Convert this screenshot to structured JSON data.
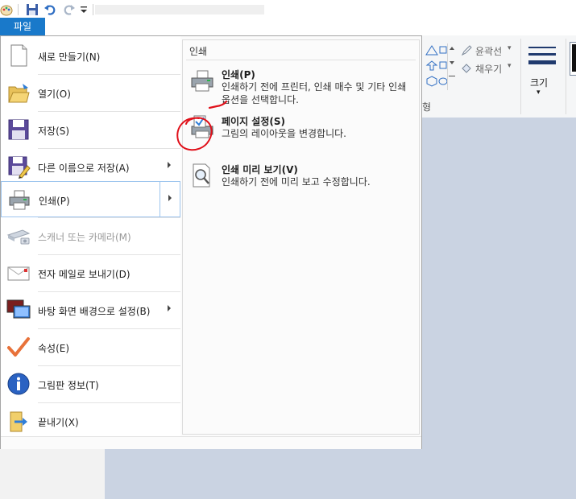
{
  "file_tab": {
    "label": "파일"
  },
  "menu": {
    "items": [
      {
        "label": "새로 만들기(N)",
        "icon": "new-document-icon"
      },
      {
        "label": "열기(O)",
        "icon": "open-folder-icon"
      },
      {
        "label": "저장(S)",
        "icon": "save-disk-icon"
      },
      {
        "label": "다른 이름으로 저장(A)",
        "icon": "save-as-icon"
      },
      {
        "label": "인쇄(P)",
        "icon": "printer-icon"
      },
      {
        "label": "스캐너 또는 카메라(M)",
        "icon": "scanner-icon"
      },
      {
        "label": "전자 메일로 보내기(D)",
        "icon": "email-icon"
      },
      {
        "label": "바탕 화면 배경으로 설정(B)",
        "icon": "desktop-background-icon"
      },
      {
        "label": "속성(E)",
        "icon": "properties-check-icon"
      },
      {
        "label": "그림판 정보(T)",
        "icon": "info-icon"
      },
      {
        "label": "끝내기(X)",
        "icon": "exit-icon"
      }
    ]
  },
  "print_panel": {
    "title": "인쇄",
    "options": [
      {
        "title": "인쇄(P)",
        "desc": "인쇄하기 전에 프린터, 인쇄 매수 및 기타 인쇄 옵션을 선택합니다."
      },
      {
        "title": "페이지 설정(S)",
        "desc": "그림의 레이아웃을 변경합니다."
      },
      {
        "title": "인쇄 미리 보기(V)",
        "desc": "인쇄하기 전에 미리 보고 수정합니다."
      }
    ]
  },
  "ribbon": {
    "outline_label": "윤곽선",
    "fill_label": "채우기",
    "size_label": "크기",
    "shapes_group_label": "형"
  },
  "colors": {
    "file_tab": "#1979ca",
    "canvas": "#cad3e2",
    "annotation": "#e0101a"
  }
}
